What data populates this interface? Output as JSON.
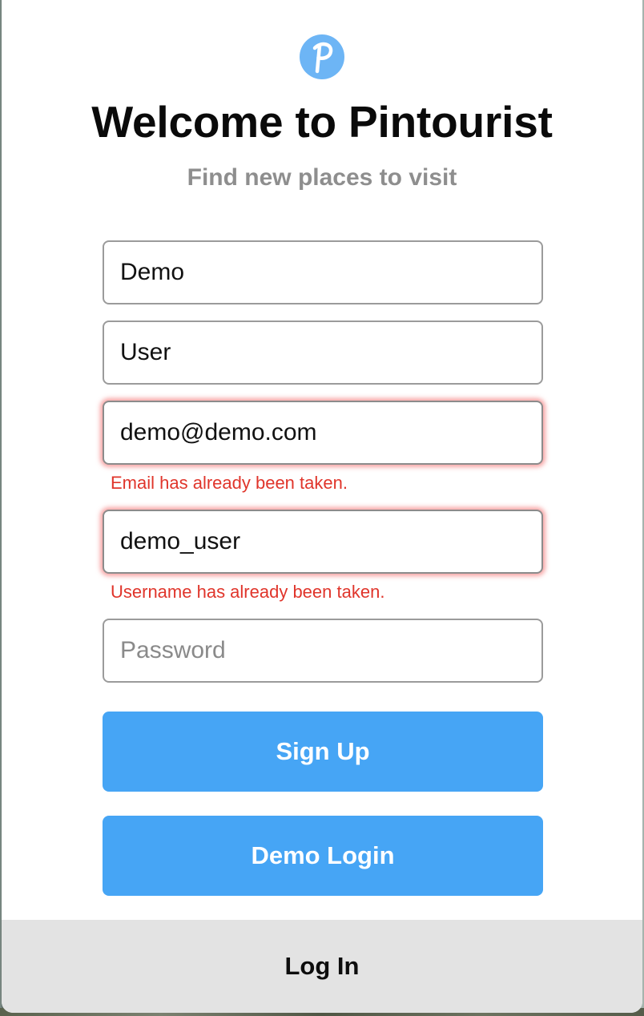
{
  "brand": {
    "logo_letter": "P",
    "logo_color": "#6db5f5"
  },
  "header": {
    "title": "Welcome to Pintourist",
    "subtitle": "Find new places to visit"
  },
  "form": {
    "first_name": {
      "value": "Demo",
      "placeholder": ""
    },
    "last_name": {
      "value": "User",
      "placeholder": ""
    },
    "email": {
      "value": "demo@demo.com",
      "placeholder": "",
      "error": "Email has already been taken."
    },
    "username": {
      "value": "demo_user",
      "placeholder": "",
      "error": "Username has already been taken."
    },
    "password": {
      "value": "",
      "placeholder": "Password"
    },
    "signup_label": "Sign Up",
    "demo_label": "Demo Login"
  },
  "footer": {
    "login_label": "Log In"
  },
  "colors": {
    "accent": "#46a5f5",
    "error": "#e0352b",
    "footer_bg": "#e3e3e3"
  }
}
